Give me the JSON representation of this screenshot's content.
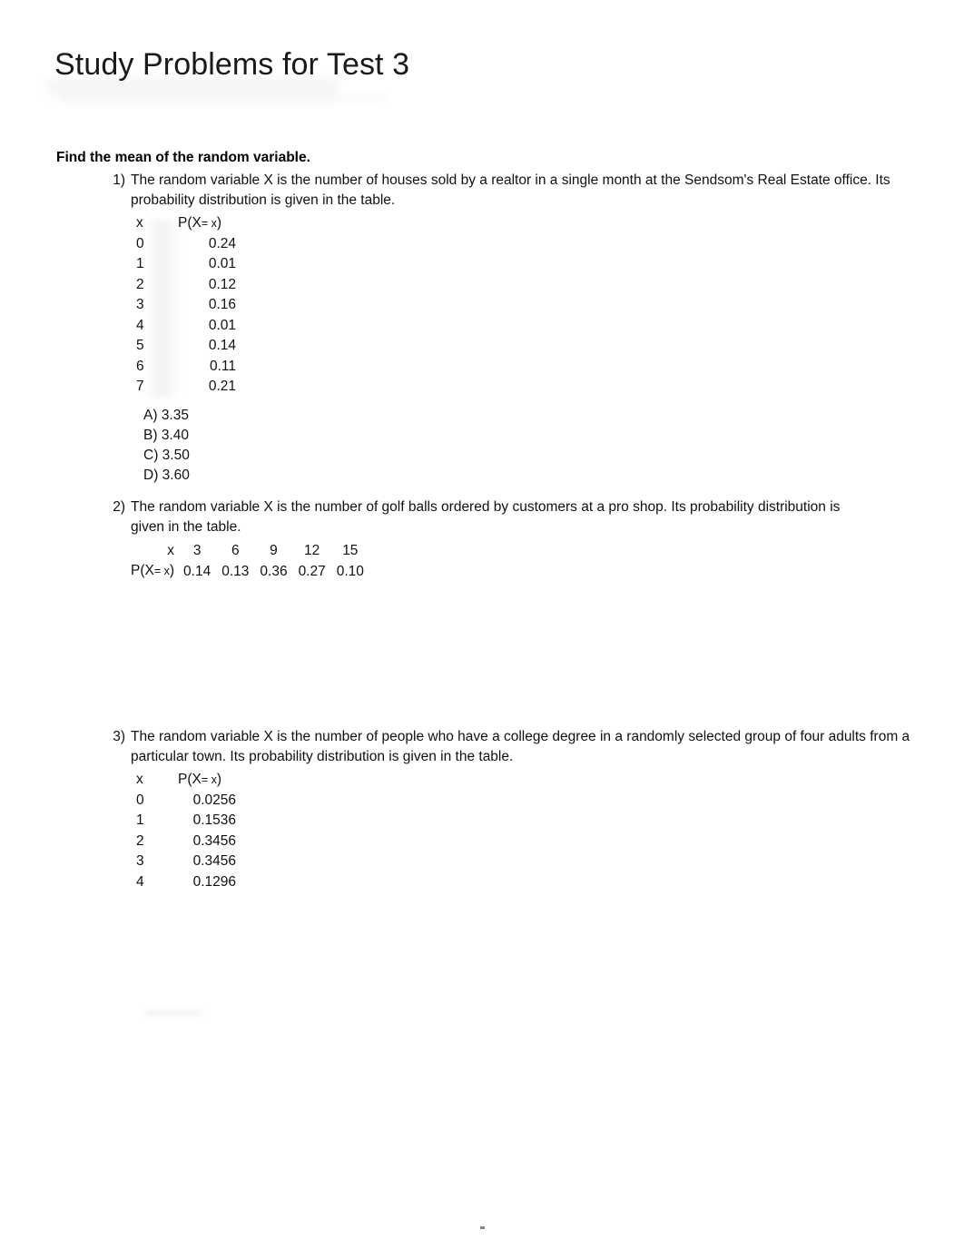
{
  "document": {
    "title": "Study Problems for Test 3",
    "section_heading": "Find the mean of the random variable.",
    "footer_mark": "."
  },
  "problems": [
    {
      "number": "1)",
      "text": "The random variable X is the number of houses sold by a realtor in a single month at the Sendsom's Real Estate office. Its probability distribution is given in the table.",
      "table": {
        "orientation": "vertical",
        "header_x": "x",
        "header_p_prefix": "P(X",
        "header_p_mid": "= x",
        "header_p_suffix": ")",
        "rows": [
          {
            "x": "0",
            "p": "0.24"
          },
          {
            "x": "1",
            "p": "0.01"
          },
          {
            "x": "2",
            "p": "0.12"
          },
          {
            "x": "3",
            "p": "0.16"
          },
          {
            "x": "4",
            "p": "0.01"
          },
          {
            "x": "5",
            "p": "0.14"
          },
          {
            "x": "6",
            "p": "0.11"
          },
          {
            "x": "7",
            "p": "0.21"
          }
        ]
      },
      "choices": [
        {
          "letter": "A)",
          "value": "3.35"
        },
        {
          "letter": "B)",
          "value": "3.40"
        },
        {
          "letter": "C)",
          "value": "3.50"
        },
        {
          "letter": "D)",
          "value": "3.60"
        }
      ]
    },
    {
      "number": "2)",
      "text": "The random variable X is the number of golf balls ordered by customers at a pro shop. Its probability distribution is given in the table.",
      "table": {
        "orientation": "horizontal",
        "row_label_x": "x",
        "row_label_p_prefix": "P(X",
        "row_label_p_mid": "= x",
        "row_label_p_suffix": ")",
        "x_values": [
          "3",
          "6",
          "9",
          "12",
          "15"
        ],
        "p_values": [
          "0.14",
          "0.13",
          "0.36",
          "0.27",
          "0.10"
        ]
      },
      "choices": []
    },
    {
      "number": "3)",
      "text": "The random variable X is the number of people who have a college degree in a randomly selected group of four adults from a particular town. Its probability distribution is given in the table.",
      "table": {
        "orientation": "vertical",
        "header_x": "x",
        "header_p_prefix": "P(X",
        "header_p_mid": "= x",
        "header_p_suffix": ")",
        "rows": [
          {
            "x": "0",
            "p": "0.0256"
          },
          {
            "x": "1",
            "p": "0.1536"
          },
          {
            "x": "2",
            "p": "0.3456"
          },
          {
            "x": "3",
            "p": "0.3456"
          },
          {
            "x": "4",
            "p": "0.1296"
          }
        ]
      },
      "choices": []
    }
  ]
}
